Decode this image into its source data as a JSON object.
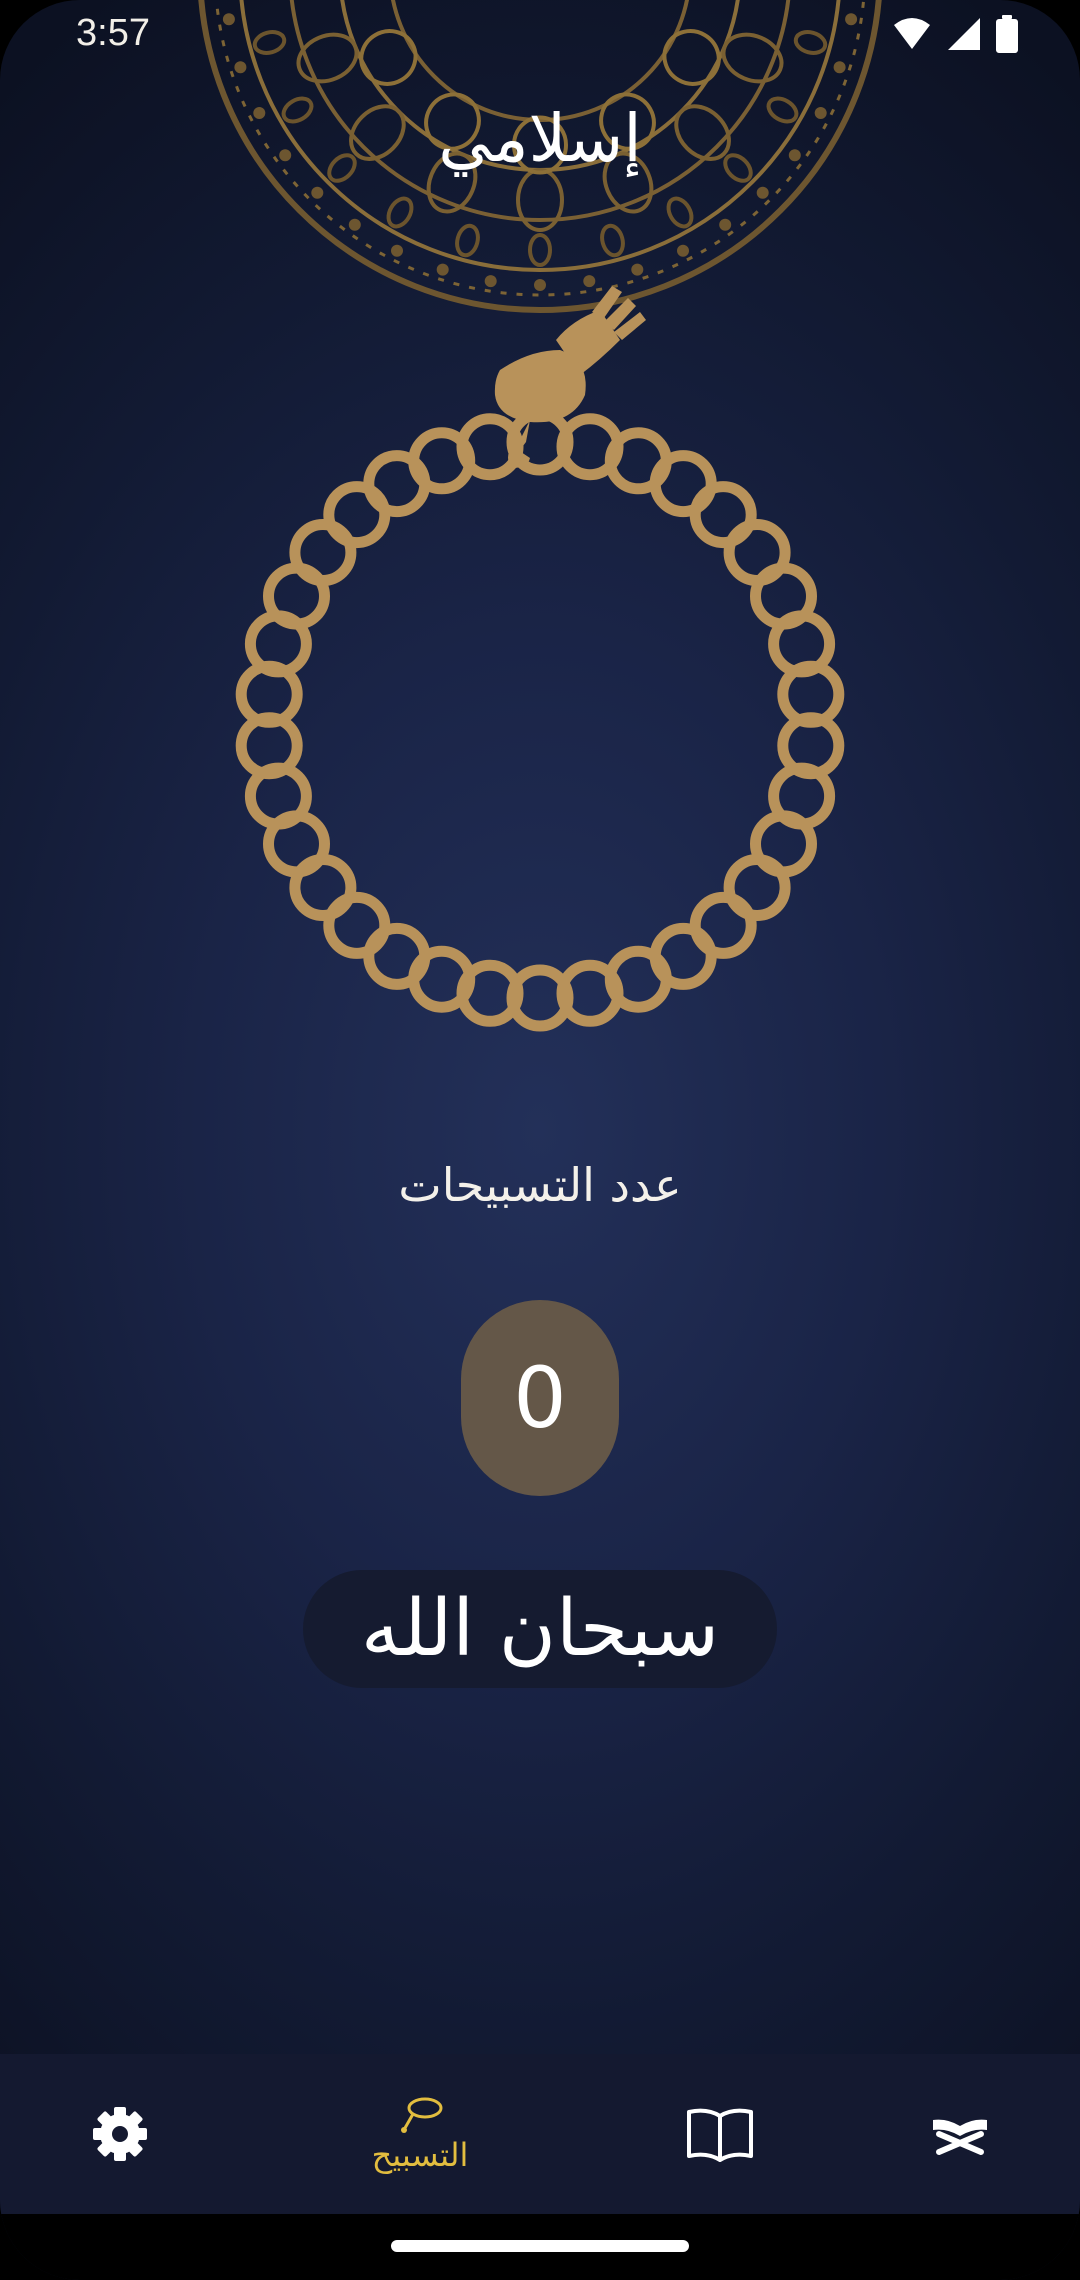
{
  "status_bar": {
    "time": "3:57",
    "icons": [
      "wifi-icon",
      "signal-icon",
      "battery-icon"
    ]
  },
  "header": {
    "title": "إسلامي"
  },
  "tasbih": {
    "count_label": "عدد التسبيحات",
    "count_value": "0",
    "dhikr_text": "سبحان الله"
  },
  "bottom_nav": {
    "items": [
      {
        "icon": "gear-icon",
        "label": ""
      },
      {
        "icon": "prayer-beads-icon",
        "label": "التسبيح",
        "active": true
      },
      {
        "icon": "open-book-icon",
        "label": ""
      },
      {
        "icon": "quran-stand-icon",
        "label": ""
      }
    ]
  },
  "colors": {
    "background_center": "#233059",
    "background_edge": "#0c1122",
    "gold": "#b8925a",
    "counter_pill": "#645748",
    "nav_background": "#141930",
    "active_nav": "#e2bd3f"
  }
}
